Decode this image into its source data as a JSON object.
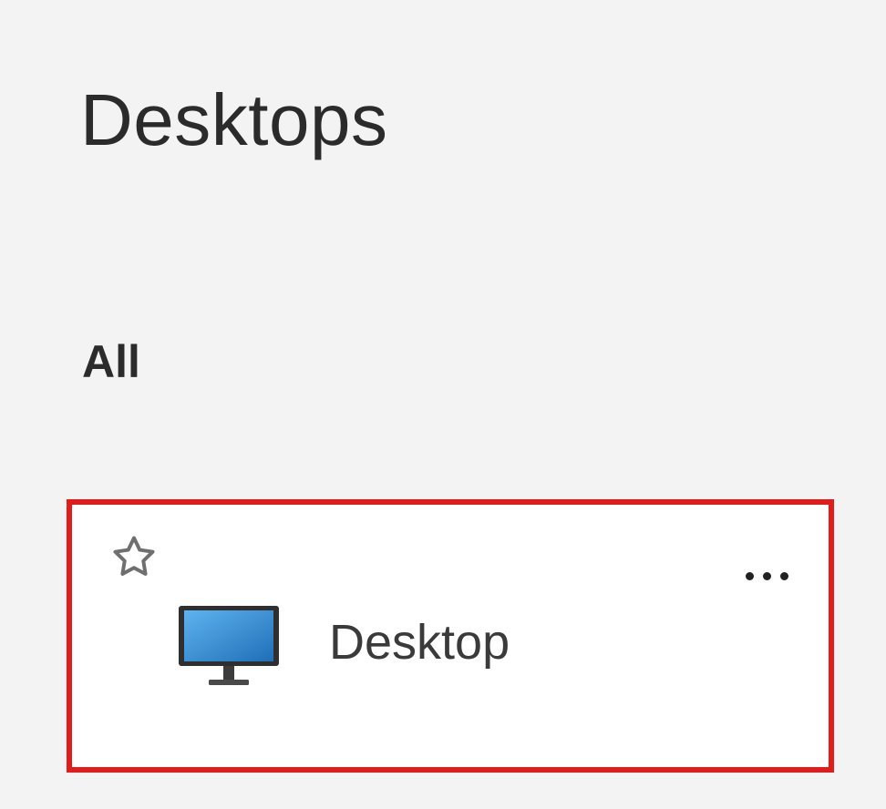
{
  "page": {
    "title": "Desktops",
    "section_label": "All"
  },
  "desktop_card": {
    "name": "Desktop",
    "favorite_icon": "star-outline-icon",
    "more_icon": "more-horizontal-icon",
    "monitor_icon": "monitor-icon",
    "highlight_color": "#e21b1b"
  }
}
